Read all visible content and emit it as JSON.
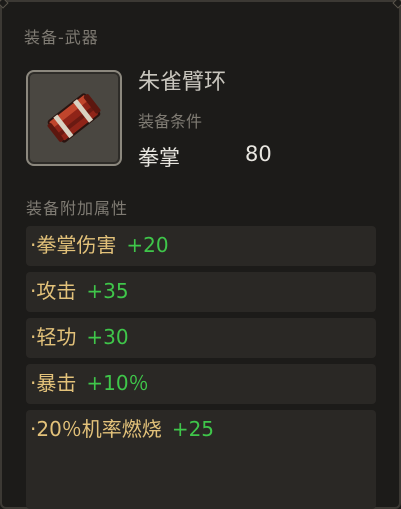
{
  "tooltip": {
    "category": "装备-武器",
    "item_name": "朱雀臂环",
    "requirement_label": "装备条件",
    "requirement_stat": "拳掌",
    "requirement_value": "80",
    "attributes_header": "装备附加属性",
    "icon": "red-armband-icon",
    "attributes": [
      {
        "name": "·拳掌伤害",
        "value": "+20"
      },
      {
        "name": "·攻击",
        "value": "+35"
      },
      {
        "name": "·轻功",
        "value": "+30"
      },
      {
        "name": "·暴击",
        "value": "+10％"
      },
      {
        "name": "·20％机率燃烧",
        "value": "+25"
      }
    ]
  },
  "colors": {
    "attr_name": "#e3c27a",
    "attr_value": "#3fc64a",
    "row_bg": "#2a2825"
  }
}
